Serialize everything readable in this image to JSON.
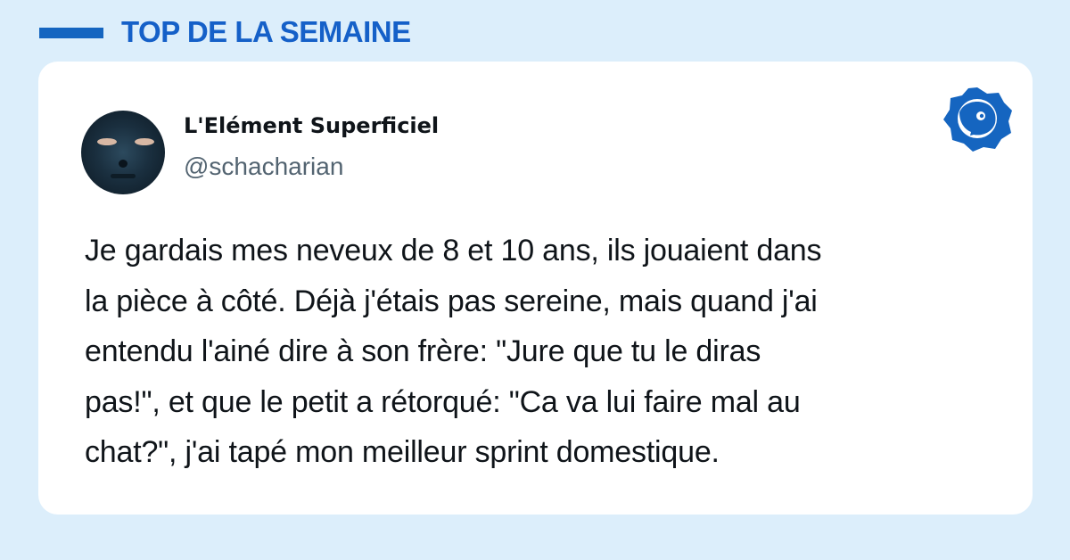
{
  "header": {
    "title": "TOP DE LA SEMAINE"
  },
  "tweet": {
    "display_name": "L'Elément Superficiel",
    "handle": "@schacharian",
    "text": "Je gardais mes neveux de 8 et 10 ans, ils jouaient dans\nla pièce à côté. Déjà j'étais pas sereine, mais quand j'ai\nentendu l'ainé dire à son frère: \"Jure que tu le diras\npas!\", et que le petit a rétorqué: \"Ca va lui faire mal au\nchat?\", j'ai tapé mon meilleur sprint domestique."
  },
  "icons": {
    "brand": "brand-logo-icon"
  },
  "colors": {
    "accent": "#1565c0",
    "background": "#dceefb",
    "card": "#ffffff",
    "text": "#0f1419",
    "muted": "#536471"
  }
}
